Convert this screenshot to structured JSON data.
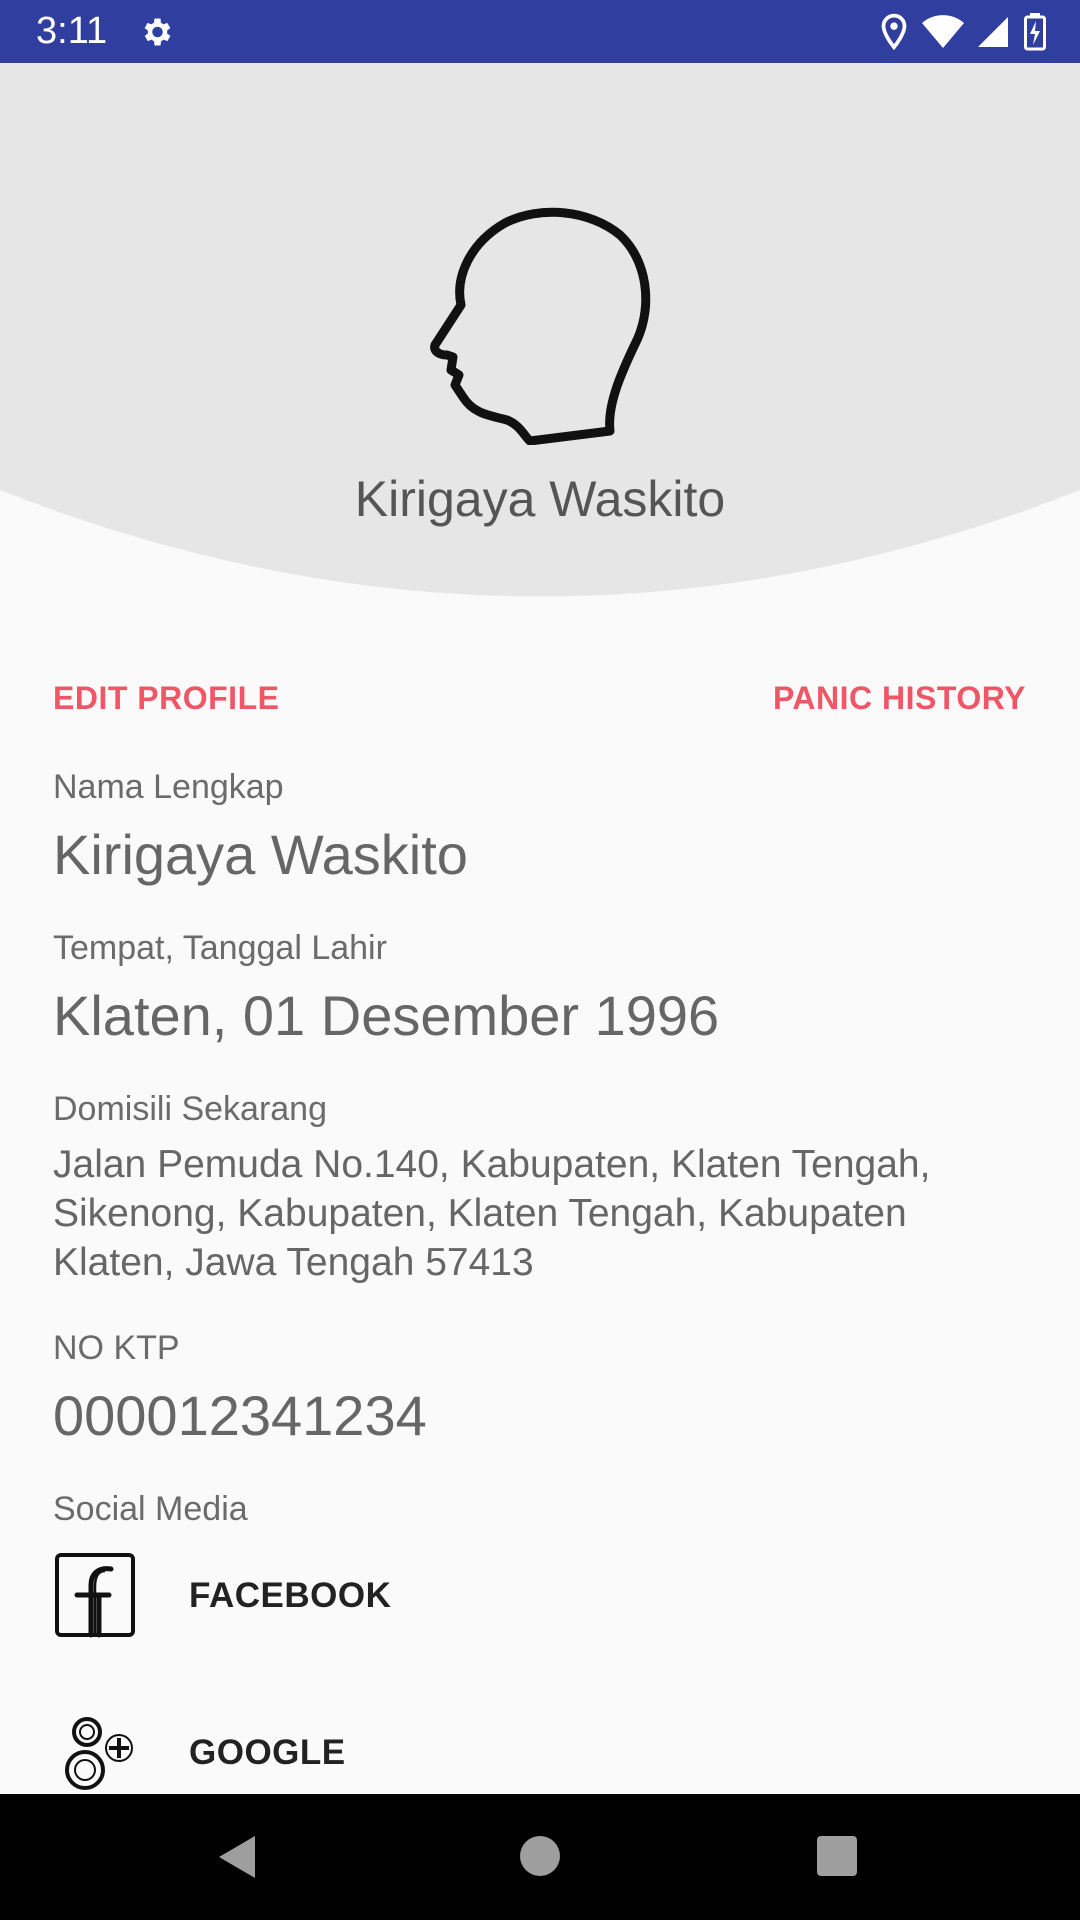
{
  "status_bar": {
    "time": "3:11",
    "icons": [
      "gear-icon",
      "location-icon",
      "wifi-icon",
      "signal-icon",
      "battery-charging-icon"
    ],
    "background_color": "#303f9f"
  },
  "profile": {
    "avatar_icon": "head-silhouette-icon",
    "display_name": "Kirigaya Waskito"
  },
  "actions": {
    "edit_profile": "EDIT PROFILE",
    "panic_history": "PANIC HISTORY",
    "accent_color": "#ef5766"
  },
  "fields": {
    "full_name": {
      "label": "Nama Lengkap",
      "value": "Kirigaya Waskito"
    },
    "birth": {
      "label": "Tempat, Tanggal Lahir",
      "value": "Klaten, 01 Desember 1996"
    },
    "address": {
      "label": "Domisili Sekarang",
      "value": "Jalan Pemuda No.140, Kabupaten, Klaten Tengah, Sikenong, Kabupaten, Klaten Tengah, Kabupaten Klaten, Jawa Tengah 57413"
    },
    "ktp": {
      "label": "NO KTP",
      "value": "000012341234"
    }
  },
  "social": {
    "label": "Social Media",
    "items": [
      {
        "icon": "facebook-icon",
        "label": "FACEBOOK"
      },
      {
        "icon": "google-plus-icon",
        "label": "GOOGLE"
      }
    ]
  },
  "nav_bar": {
    "icons": [
      "back-icon",
      "home-icon",
      "recents-icon"
    ]
  }
}
